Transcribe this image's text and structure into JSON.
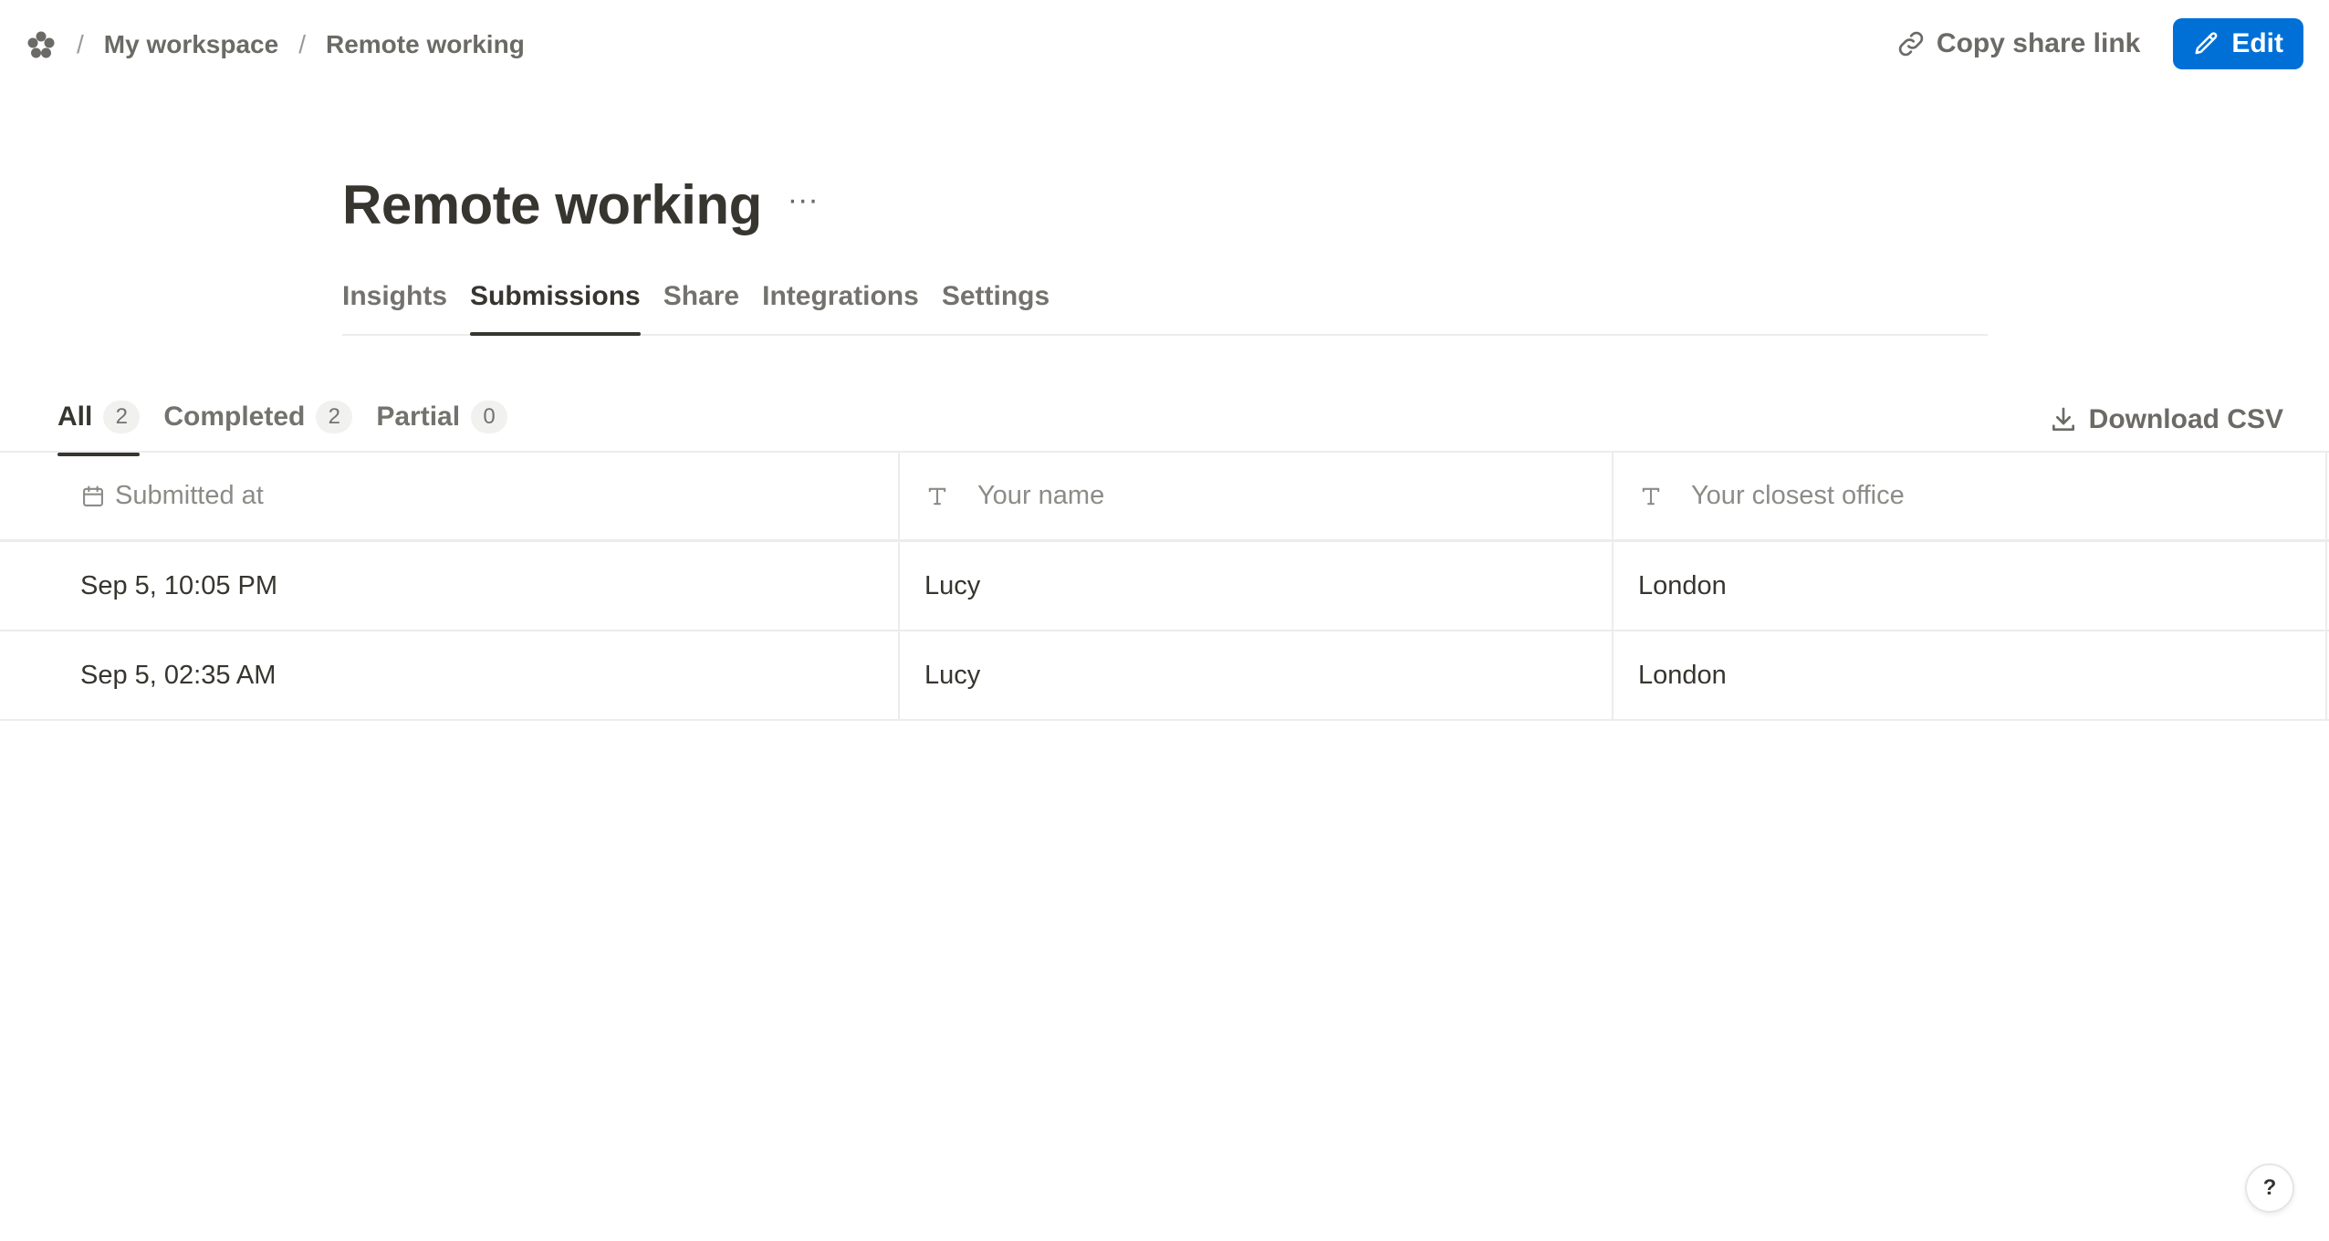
{
  "breadcrumb": {
    "logo_icon": "flower-logo-icon",
    "workspace": "My workspace",
    "current": "Remote working",
    "separator": "/"
  },
  "actions": {
    "copy_link_label": "Copy share link",
    "copy_link_icon": "link-icon",
    "edit_label": "Edit",
    "edit_icon": "pencil-icon",
    "edit_color": "#0070d7"
  },
  "page": {
    "title": "Remote working",
    "more": "···"
  },
  "tabs": [
    {
      "label": "Insights",
      "active": false
    },
    {
      "label": "Submissions",
      "active": true
    },
    {
      "label": "Share",
      "active": false
    },
    {
      "label": "Integrations",
      "active": false
    },
    {
      "label": "Settings",
      "active": false
    }
  ],
  "filters": [
    {
      "label": "All",
      "count": "2",
      "active": true
    },
    {
      "label": "Completed",
      "count": "2",
      "active": false
    },
    {
      "label": "Partial",
      "count": "0",
      "active": false
    }
  ],
  "download": {
    "label": "Download CSV",
    "icon": "download-icon"
  },
  "table": {
    "columns": [
      {
        "label": "Submitted at",
        "icon": "calendar-icon"
      },
      {
        "label": "Your name",
        "icon": "text-type-icon"
      },
      {
        "label": "Your closest office",
        "icon": "text-type-icon"
      }
    ],
    "rows": [
      [
        "Sep 5, 10:05 PM",
        "Lucy",
        "London"
      ],
      [
        "Sep 5, 02:35 AM",
        "Lucy",
        "London"
      ]
    ]
  },
  "help": {
    "label": "?"
  }
}
